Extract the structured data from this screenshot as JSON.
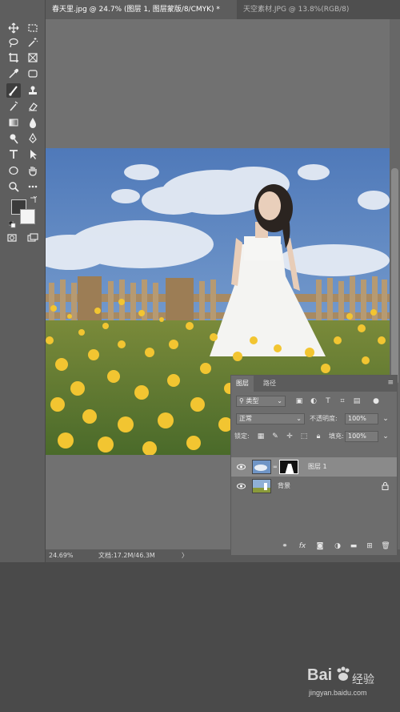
{
  "tabs": {
    "active": "春天里.jpg @ 24.7% (图层 1, 图层蒙版/8/CMYK) *",
    "inactive": "天空素材.JPG @ 13.8%(RGB/8)"
  },
  "status": {
    "zoom": "24.69%",
    "doc": "文档:17.2M/46.3M",
    "arrow": "〉"
  },
  "layers_panel": {
    "tab_layers": "图层",
    "tab_paths": "路径",
    "filter_kind": "类型",
    "blend_mode": "正常",
    "opacity_label": "不透明度:",
    "opacity_value": "100%",
    "lock_label": "锁定:",
    "fill_label": "填充:",
    "fill_value": "100%",
    "layers": [
      {
        "name": "图层 1",
        "selected": true,
        "has_mask": true,
        "locked": false
      },
      {
        "name": "背景",
        "selected": false,
        "has_mask": false,
        "locked": true
      }
    ],
    "bottom_icons": [
      "link-icon",
      "fx-icon",
      "mask-icon",
      "adjustment-icon",
      "group-icon",
      "new-layer-icon",
      "trash-icon"
    ]
  },
  "colors": {
    "foreground": "#3b3b3b",
    "background": "#f4f4f4",
    "panel_bg": "#6d6d6d",
    "canvas_bg": "#717171"
  },
  "watermark": {
    "brand": "Bai",
    "brand_suffix": "经验",
    "url": "jingyan.baidu.com"
  }
}
